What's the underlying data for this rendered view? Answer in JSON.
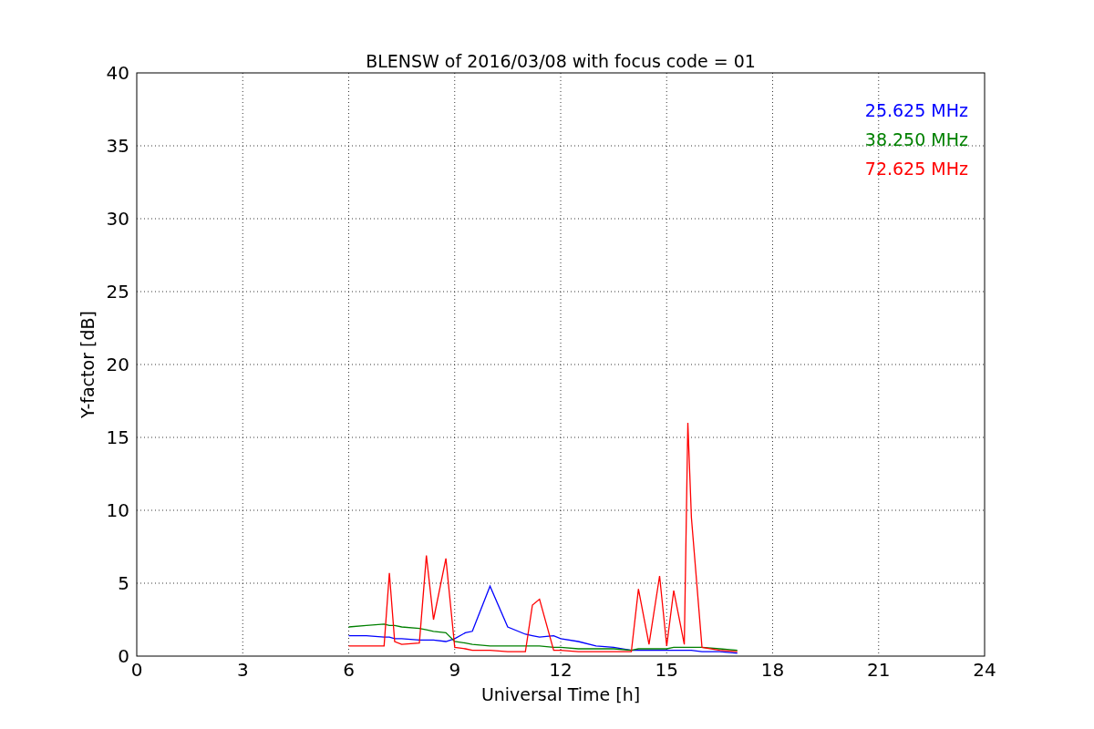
{
  "chart_data": {
    "type": "line",
    "title": "BLENSW of 2016/03/08 with focus code = 01",
    "xlabel": "Universal Time [h]",
    "ylabel": "Y-factor [dB]",
    "xlim": [
      0,
      24
    ],
    "ylim": [
      0,
      40
    ],
    "xticks": [
      0,
      3,
      6,
      9,
      12,
      15,
      18,
      21,
      24
    ],
    "yticks": [
      0,
      5,
      10,
      15,
      20,
      25,
      30,
      35,
      40
    ],
    "grid": true,
    "x": [
      6,
      6.5,
      7,
      7.15,
      7.3,
      7.5,
      8,
      8.2,
      8.4,
      8.75,
      9,
      9.3,
      9.5,
      10,
      10.5,
      11,
      11.2,
      11.4,
      11.8,
      12,
      12.5,
      13,
      13.5,
      14,
      14.2,
      14.5,
      14.8,
      15,
      15.2,
      15.5,
      15.6,
      15.7,
      16,
      16.5,
      17
    ],
    "series": [
      {
        "name": "25.625 MHz",
        "color": "#0000ff",
        "values": [
          1.4,
          1.4,
          1.3,
          1.3,
          1.2,
          1.2,
          1.1,
          1.1,
          1.1,
          1.0,
          1.2,
          1.6,
          1.7,
          4.8,
          2.0,
          1.5,
          1.4,
          1.3,
          1.4,
          1.2,
          1.0,
          0.7,
          0.6,
          0.4,
          0.4,
          0.4,
          0.4,
          0.4,
          0.4,
          0.4,
          0.4,
          0.4,
          0.3,
          0.3,
          0.2
        ]
      },
      {
        "name": "38.250 MHz",
        "color": "#008000",
        "values": [
          2.0,
          2.1,
          2.2,
          2.1,
          2.1,
          2.0,
          1.9,
          1.8,
          1.7,
          1.6,
          1.0,
          0.9,
          0.8,
          0.7,
          0.7,
          0.7,
          0.7,
          0.7,
          0.6,
          0.6,
          0.5,
          0.5,
          0.5,
          0.4,
          0.5,
          0.5,
          0.5,
          0.5,
          0.6,
          0.6,
          0.6,
          0.6,
          0.6,
          0.5,
          0.4
        ]
      },
      {
        "name": "72.625 MHz",
        "color": "#ff0000",
        "values": [
          0.7,
          0.7,
          0.7,
          5.7,
          1.0,
          0.8,
          0.9,
          6.9,
          2.5,
          6.7,
          0.6,
          0.5,
          0.4,
          0.4,
          0.3,
          0.3,
          3.5,
          3.9,
          0.4,
          0.4,
          0.3,
          0.3,
          0.3,
          0.3,
          4.6,
          0.8,
          5.5,
          0.7,
          4.5,
          0.8,
          16.0,
          9.5,
          0.6,
          0.4,
          0.3
        ]
      }
    ]
  }
}
